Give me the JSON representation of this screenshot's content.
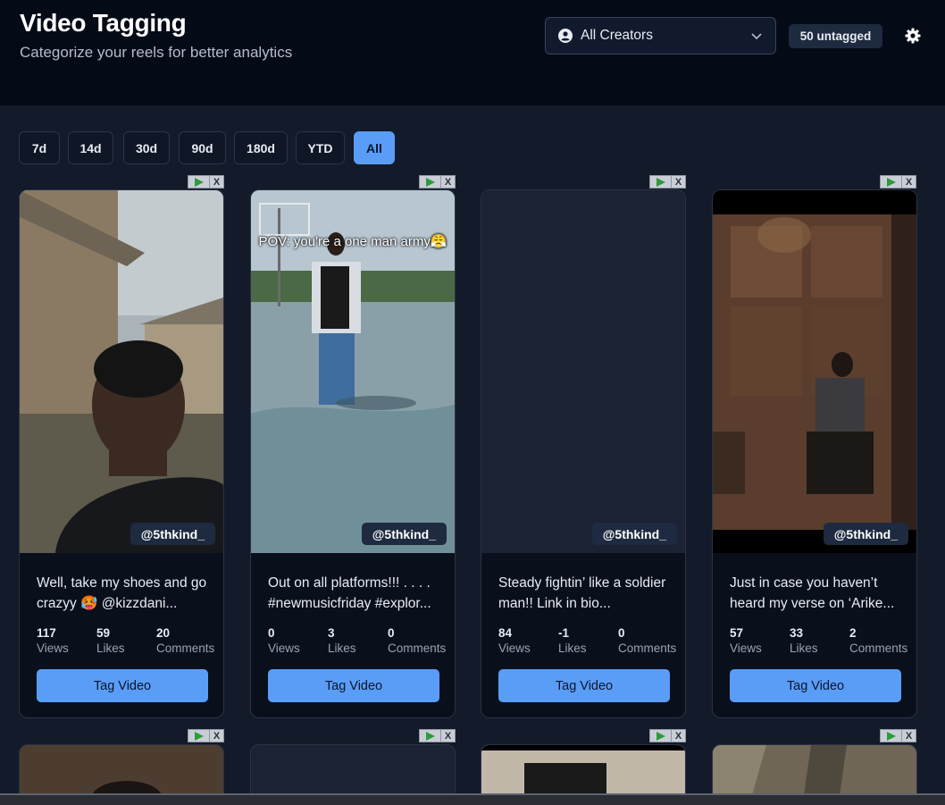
{
  "header": {
    "title": "Video Tagging",
    "subtitle": "Categorize your reels for better analytics",
    "creator_select": {
      "value": "All Creators",
      "icon": "user-circle-icon"
    },
    "untagged_badge": "50 untagged",
    "settings_icon": "gear-icon"
  },
  "ranges": {
    "items": [
      "7d",
      "14d",
      "30d",
      "90d",
      "180d",
      "YTD",
      "All"
    ],
    "selected": "All"
  },
  "ad_close": "X",
  "cards": [
    {
      "handle": "@5thkind_",
      "caption": "Well, take my shoes and go crazyy 🥵 @kizzdani...",
      "views": "117",
      "likes": "59",
      "comments": "20",
      "thumb_overlay": "",
      "button": "Tag Video"
    },
    {
      "handle": "@5thkind_",
      "caption": "Out on all platforms!!! . . . . #newmusicfriday #explor...",
      "views": "0",
      "likes": "3",
      "comments": "0",
      "thumb_overlay": "POV: you're a one man army😤",
      "button": "Tag Video"
    },
    {
      "handle": "@5thkind_",
      "caption": "Steady fightin’ like a soldier man!! Link in bio...",
      "views": "84",
      "likes": "-1",
      "comments": "0",
      "thumb_overlay": "",
      "button": "Tag Video"
    },
    {
      "handle": "@5thkind_",
      "caption": "Just in case you haven’t heard my verse on ‘Arike...",
      "views": "57",
      "likes": "33",
      "comments": "2",
      "thumb_overlay": "",
      "button": "Tag Video"
    }
  ],
  "stat_labels": {
    "views": "Views",
    "likes": "Likes",
    "comments": "Comments"
  }
}
